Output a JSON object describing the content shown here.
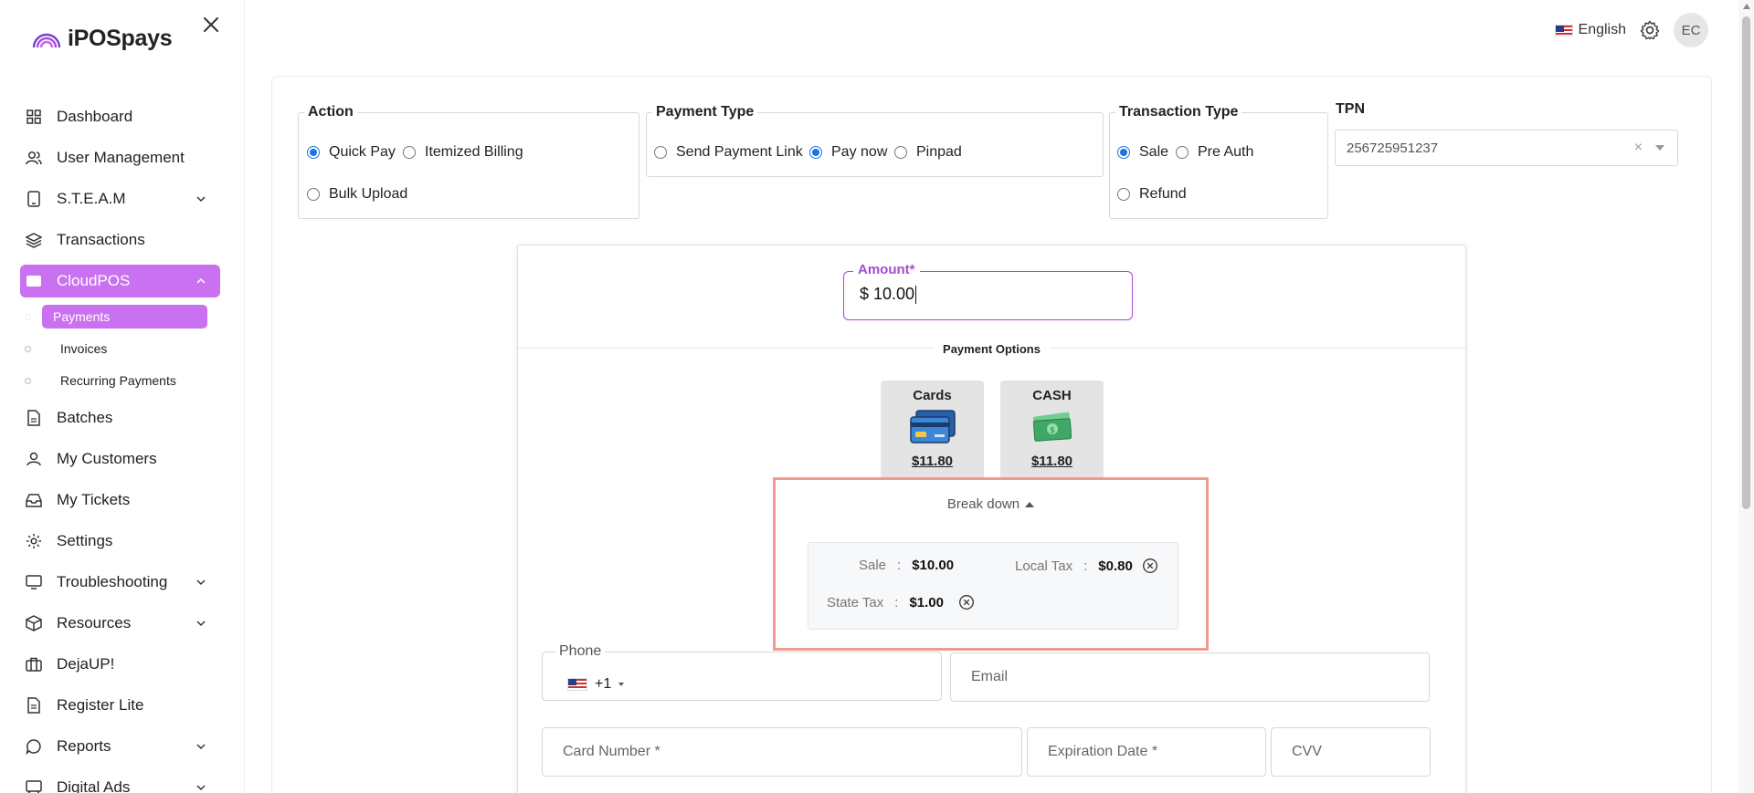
{
  "brand": {
    "name": "iPOSpays"
  },
  "topbar": {
    "language": "English",
    "avatar_initials": "EC"
  },
  "sidebar": {
    "items": [
      {
        "label": "Dashboard",
        "icon": "grid-icon"
      },
      {
        "label": "User Management",
        "icon": "users-icon"
      },
      {
        "label": "S.T.E.A.M",
        "icon": "tablet-icon",
        "expandable": true
      },
      {
        "label": "Transactions",
        "icon": "layers-icon"
      },
      {
        "label": "CloudPOS",
        "icon": "window-icon",
        "expandable": true,
        "active": true
      },
      {
        "label": "Batches",
        "icon": "file-icon"
      },
      {
        "label": "My Customers",
        "icon": "user-icon"
      },
      {
        "label": "My Tickets",
        "icon": "inbox-icon"
      },
      {
        "label": "Settings",
        "icon": "gear-icon"
      },
      {
        "label": "Troubleshooting",
        "icon": "monitor-icon",
        "expandable": true
      },
      {
        "label": "Resources",
        "icon": "box-icon",
        "expandable": true
      },
      {
        "label": "DejaUP!",
        "icon": "briefcase-icon"
      },
      {
        "label": "Register Lite",
        "icon": "document-icon"
      },
      {
        "label": "Reports",
        "icon": "chat-icon",
        "expandable": true
      },
      {
        "label": "Digital Ads",
        "icon": "display-icon",
        "expandable": true
      }
    ],
    "subitems": [
      {
        "label": "Payments",
        "active": true
      },
      {
        "label": "Invoices"
      },
      {
        "label": "Recurring Payments"
      }
    ],
    "active_color": "#c971f0"
  },
  "action": {
    "legend": "Action",
    "options": [
      "Quick Pay",
      "Itemized Billing",
      "Bulk Upload"
    ],
    "selected": "Quick Pay"
  },
  "payment_type": {
    "legend": "Payment Type",
    "options": [
      "Send Payment Link",
      "Pay now",
      "Pinpad"
    ],
    "selected": "Pay now"
  },
  "transaction_type": {
    "legend": "Transaction Type",
    "options": [
      "Sale",
      "Pre Auth",
      "Refund"
    ],
    "selected": "Sale"
  },
  "tpn": {
    "label": "TPN",
    "value": "256725951237",
    "clear": "×"
  },
  "amount": {
    "label": "Amount*",
    "value": "$ 10.00"
  },
  "payment_options": {
    "title": "Payment Options",
    "cards": {
      "label": "Cards",
      "price": "$11.80"
    },
    "cash": {
      "label": "CASH",
      "price": "$11.80"
    }
  },
  "breakdown": {
    "toggle": "Break down",
    "sale_label": "Sale",
    "sale_value": "$10.00",
    "local_tax_label": "Local Tax",
    "local_tax_value": "$0.80",
    "state_tax_label": "State Tax",
    "state_tax_value": "$1.00",
    "separator": ":"
  },
  "form": {
    "phone_label": "Phone",
    "phone_code": "+1",
    "email_placeholder": "Email",
    "card_number_placeholder": "Card Number *",
    "expiration_placeholder": "Expiration Date *",
    "cvv_placeholder": "CVV"
  },
  "colors": {
    "accent": "#c971f0",
    "amount_border": "#a34bd0",
    "highlight": "#ef9a8f",
    "radio": "#1a73e8"
  }
}
